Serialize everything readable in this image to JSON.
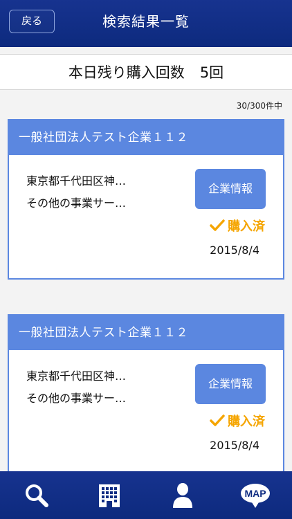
{
  "header": {
    "back_label": "戻る",
    "title": "検索結果一覧"
  },
  "remaining": {
    "label": "本日残り購入回数",
    "count": "5回"
  },
  "result_count": "30/300件中",
  "cards": [
    {
      "company": "一般社団法人テスト企業１１２",
      "address": "東京都千代田区神…",
      "business": "その他の事業サー…",
      "info_button": "企業情報",
      "status": "購入済",
      "date": "2015/8/4"
    },
    {
      "company": "一般社団法人テスト企業１１２",
      "address": "東京都千代田区神…",
      "business": "その他の事業サー…",
      "info_button": "企業情報",
      "status": "購入済",
      "date": "2015/8/4"
    }
  ],
  "nav": {
    "map_label": "MAP"
  },
  "colors": {
    "header_bg": "#17338f",
    "accent": "#5b87e0",
    "purchased": "#f5a500"
  },
  "icons": [
    "search-icon",
    "building-icon",
    "person-icon",
    "map-icon"
  ]
}
